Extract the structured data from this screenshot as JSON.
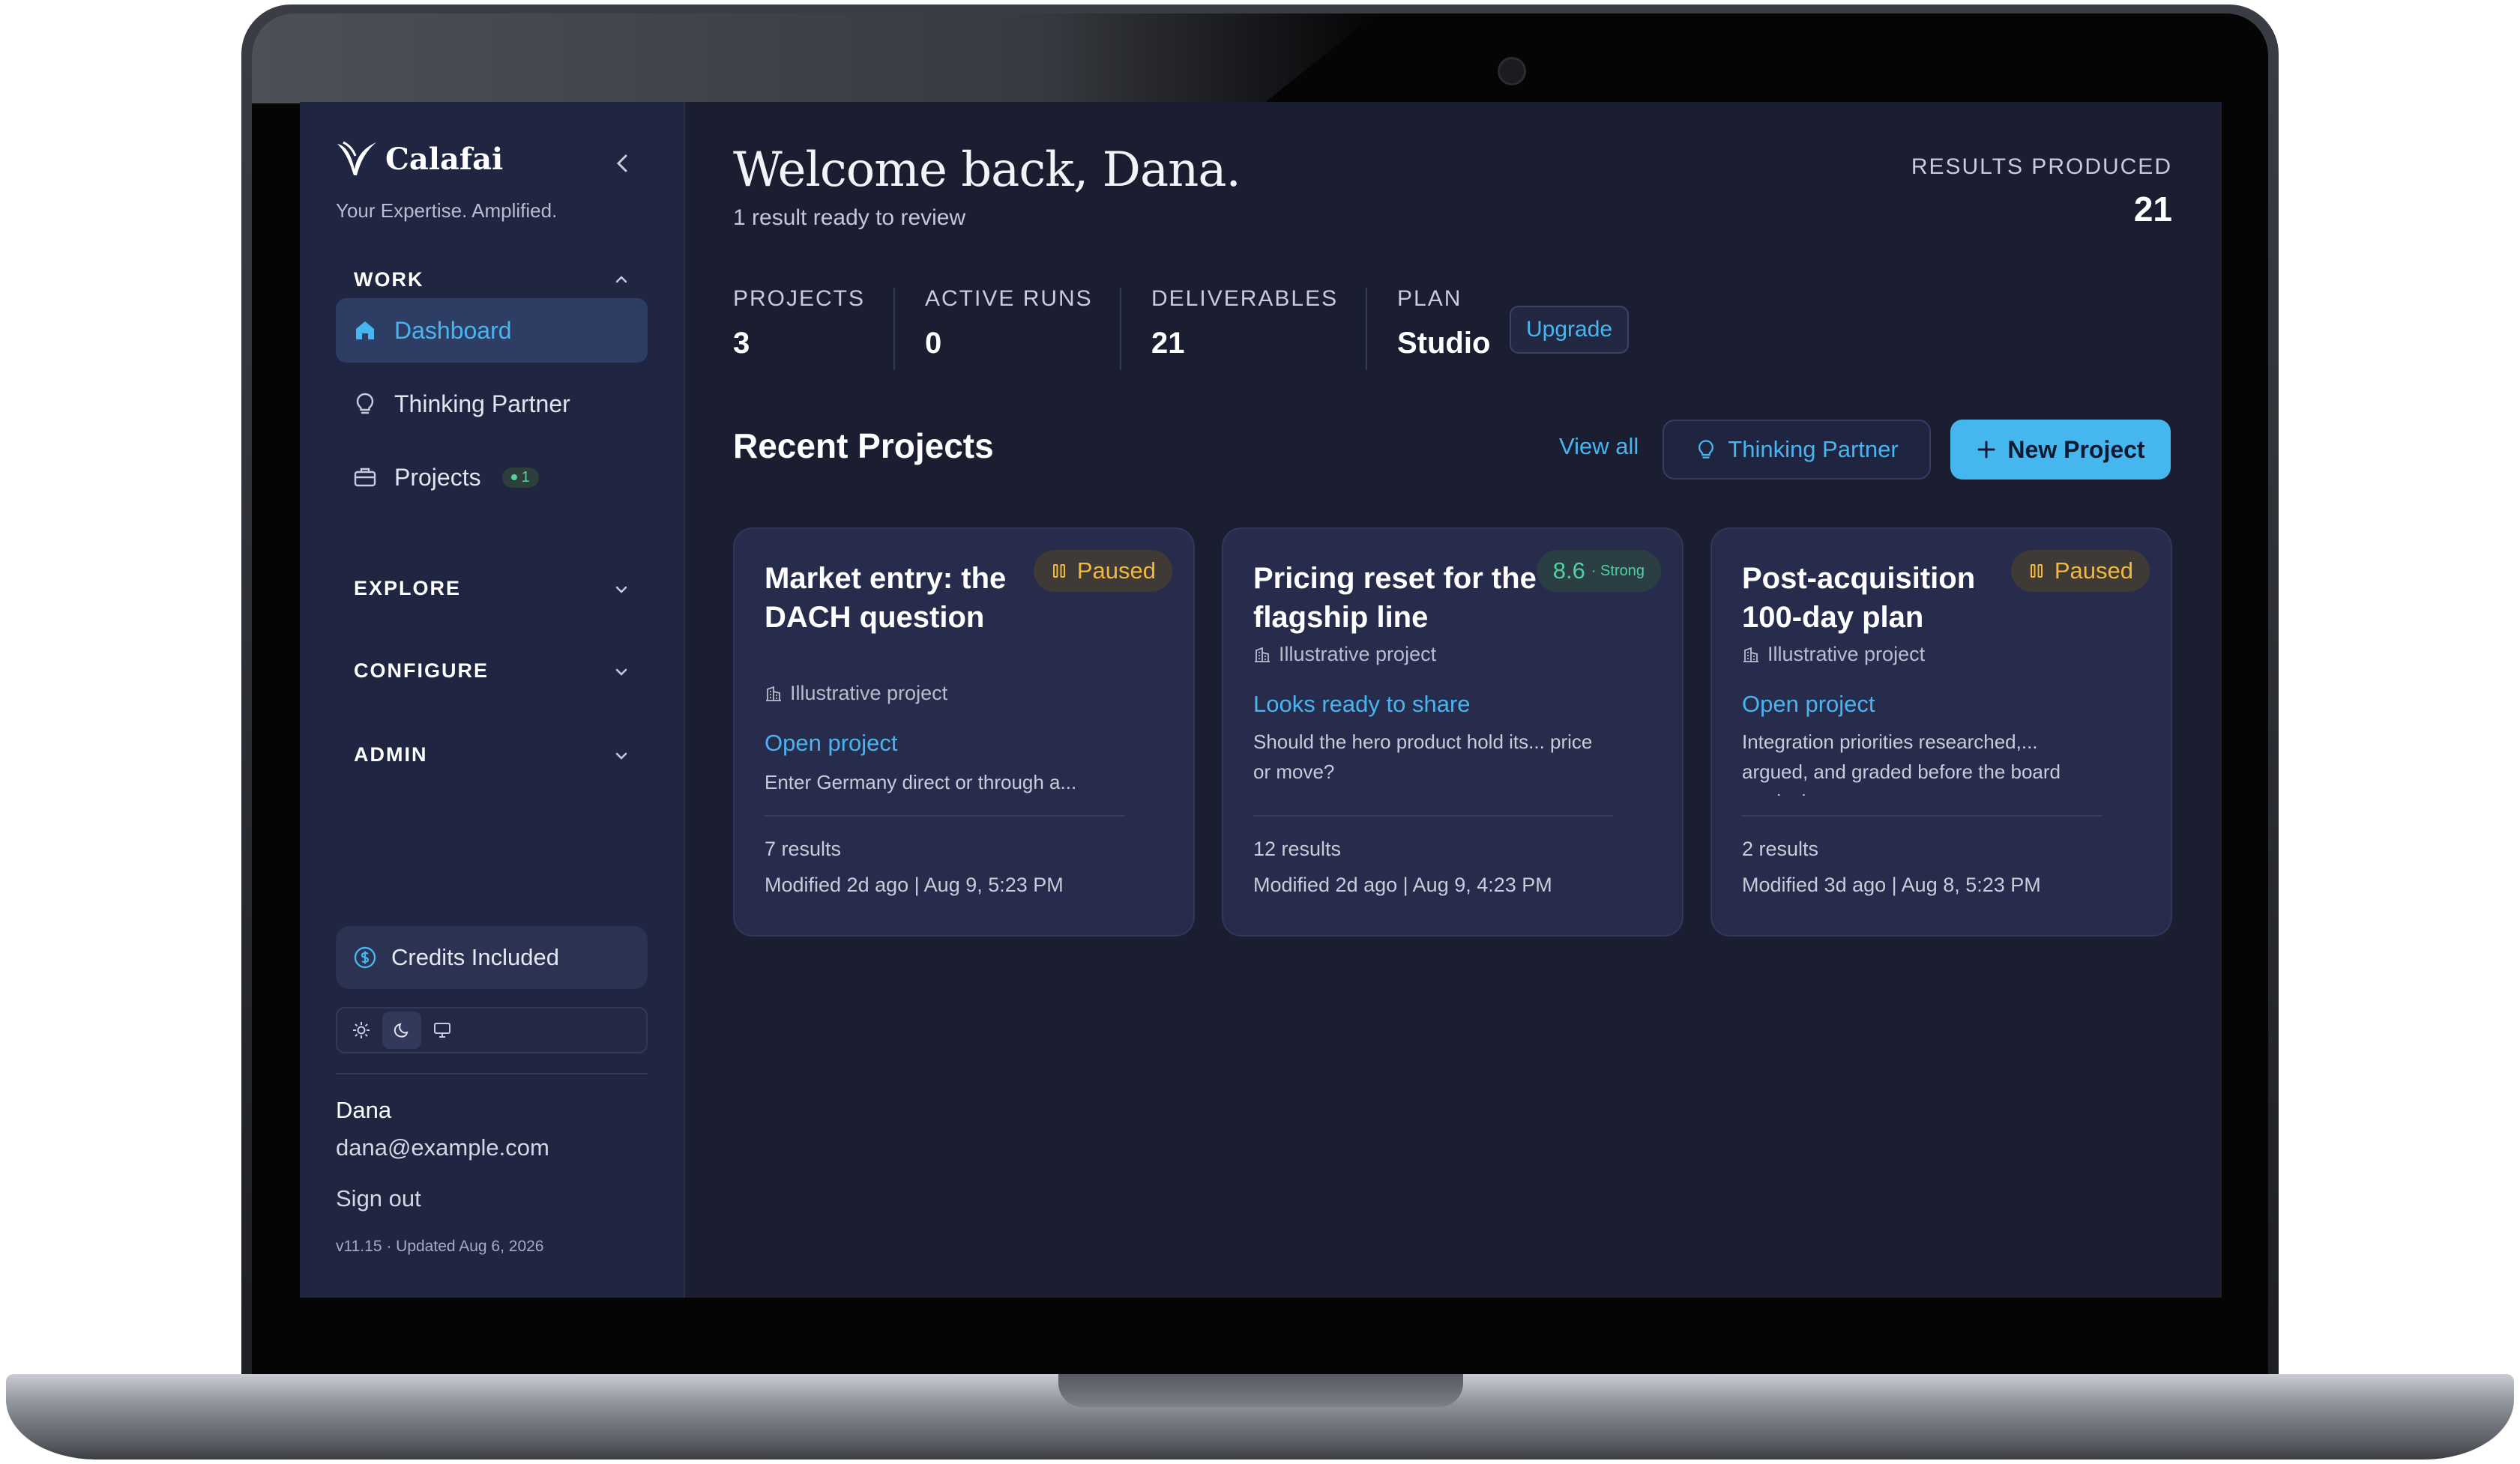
{
  "brand": {
    "name": "Calafai",
    "tagline": "Your Expertise. Amplified."
  },
  "sidebar": {
    "work_label": "WORK",
    "items": [
      {
        "label": "Dashboard",
        "icon": "home-icon",
        "active": true
      },
      {
        "label": "Thinking Partner",
        "icon": "lightbulb-icon"
      },
      {
        "label": "Projects",
        "icon": "briefcase-icon",
        "count": "1"
      }
    ],
    "sections": [
      "EXPLORE",
      "CONFIGURE",
      "ADMIN"
    ],
    "credits": "Credits Included",
    "theme_options": [
      "sun-icon",
      "moon-icon",
      "monitor-icon"
    ],
    "user": {
      "name": "Dana",
      "email": "dana@example.com"
    },
    "signout": "Sign out",
    "version": "v11.15 · Updated Aug 6, 2026"
  },
  "header": {
    "welcome": "Welcome back, Dana.",
    "subtitle": "1 result ready to review",
    "results_label": "RESULTS PRODUCED",
    "results_value": "21"
  },
  "stats": [
    {
      "label": "PROJECTS",
      "value": "3"
    },
    {
      "label": "ACTIVE RUNS",
      "value": "0"
    },
    {
      "label": "DELIVERABLES",
      "value": "21"
    },
    {
      "label": "PLAN",
      "value": "Studio"
    }
  ],
  "upgrade_label": "Upgrade",
  "recent": {
    "title": "Recent Projects",
    "view_all": "View all",
    "thinking_partner": "Thinking Partner",
    "new_project": "New Project"
  },
  "projects": [
    {
      "title": "Market entry: the DACH question",
      "badge": "Paused",
      "illustrative": "Illustrative project",
      "link": "Open project",
      "description": "Enter Germany direct or through a...",
      "results": "7 results",
      "modified": "Modified 2d ago | Aug 9, 5:23 PM"
    },
    {
      "title": "Pricing reset for the flagship line",
      "badge": "8.6",
      "badge_sub": "· Strong",
      "illustrative": "Illustrative project",
      "link": "Looks ready to share",
      "description": "Should the hero product hold its... price or move?",
      "results": "12 results",
      "modified": "Modified 2d ago | Aug 9, 4:23 PM"
    },
    {
      "title": "Post-acquisition 100-day plan",
      "badge": "Paused",
      "illustrative": "Illustrative project",
      "link": "Open project",
      "description": "Integration priorities researched,... argued, and graded before the board reads them",
      "results": "2 results",
      "modified": "Modified 3d ago | Aug 8, 5:23 PM"
    }
  ],
  "colors": {
    "accent": "#48b5f0",
    "background": "#1b1d31",
    "sidebar": "#202542",
    "paused": "#f2b93a",
    "strong": "#4fd1a3"
  }
}
